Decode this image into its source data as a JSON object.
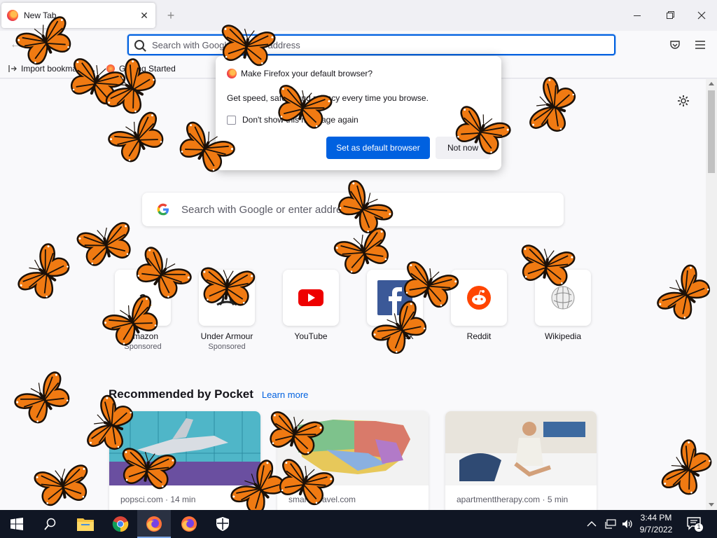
{
  "browser": {
    "tab_title": "New Tab",
    "tab_close": "✕",
    "new_tab": "+",
    "url_placeholder": "Search with Google or enter address",
    "back": "←"
  },
  "bookmarks": {
    "items": [
      {
        "label": "Import bookmarks..."
      },
      {
        "label": "Getting Started"
      }
    ]
  },
  "newtab": {
    "search_placeholder": "Search with Google or enter address",
    "shortcuts": [
      {
        "label": "Amazon",
        "sublabel": "Sponsored",
        "icon": "amazon-icon"
      },
      {
        "label": "Under Armour",
        "sublabel": "Sponsored",
        "icon": "under-armour-icon"
      },
      {
        "label": "YouTube",
        "sublabel": "",
        "icon": "youtube-icon"
      },
      {
        "label": "Facebook",
        "sublabel": "",
        "icon": "facebook-icon"
      },
      {
        "label": "Reddit",
        "sublabel": "",
        "icon": "reddit-icon"
      },
      {
        "label": "Wikipedia",
        "sublabel": "",
        "icon": "wikipedia-icon"
      }
    ],
    "pocket_title": "Recommended by Pocket",
    "pocket_link": "Learn more",
    "cards": [
      {
        "source": "popsci.com · 14 min"
      },
      {
        "source": "smartertravel.com"
      },
      {
        "source": "apartmenttherapy.com · 5 min"
      }
    ]
  },
  "dialog": {
    "title": "Make Firefox your default browser?",
    "body": "Get speed, safety, and privacy every time you browse.",
    "checkbox_label": "Don't show this message again",
    "primary_button": "Set as default browser",
    "secondary_button": "Not now"
  },
  "taskbar": {
    "time": "3:44 PM",
    "date": "9/7/2022",
    "notification_count": "1"
  },
  "colors": {
    "accent": "#0061e0",
    "taskbar": "#101624",
    "butterfly_orange": "#f07a12"
  }
}
